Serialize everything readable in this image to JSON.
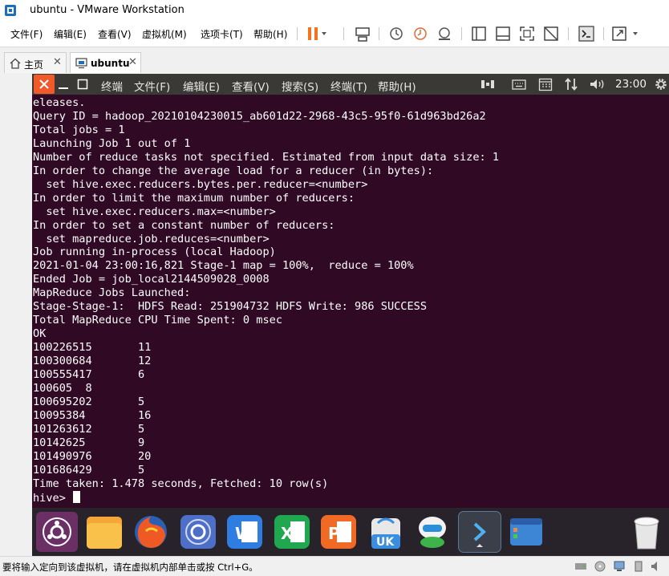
{
  "window": {
    "title": "ubuntu - VMware Workstation"
  },
  "menu": {
    "items": [
      "文件(F)",
      "编辑(E)",
      "查看(V)",
      "虚拟机(M)",
      "选项卡(T)",
      "帮助(H)"
    ]
  },
  "tabs": [
    {
      "label": "主页"
    },
    {
      "label": "ubuntu"
    }
  ],
  "ubuntu": {
    "app_name": "终端",
    "menu": [
      "文件(F)",
      "编辑(E)",
      "查看(V)",
      "搜索(S)",
      "终端(T)",
      "帮助(H)"
    ],
    "clock": "23:00"
  },
  "terminal": {
    "lines": [
      "eleases.",
      "Query ID = hadoop_20210104230015_ab601d22-2968-43c5-95f0-61d963bd26a2",
      "Total jobs = 1",
      "Launching Job 1 out of 1",
      "Number of reduce tasks not specified. Estimated from input data size: 1",
      "In order to change the average load for a reducer (in bytes):",
      "  set hive.exec.reducers.bytes.per.reducer=<number>",
      "In order to limit the maximum number of reducers:",
      "  set hive.exec.reducers.max=<number>",
      "In order to set a constant number of reducers:",
      "  set mapreduce.job.reduces=<number>",
      "Job running in-process (local Hadoop)",
      "2021-01-04 23:00:16,821 Stage-1 map = 100%,  reduce = 100%",
      "Ended Job = job_local2144509028_0008",
      "MapReduce Jobs Launched:",
      "Stage-Stage-1:  HDFS Read: 251904732 HDFS Write: 986 SUCCESS",
      "Total MapReduce CPU Time Spent: 0 msec",
      "OK",
      "100226515\t11",
      "100300684\t12",
      "100555417\t6",
      "100605\t8",
      "100695202\t5",
      "10095384\t16",
      "101263612\t5",
      "10142625\t9",
      "101490976\t20",
      "101686429\t5",
      "Time taken: 1.478 seconds, Fetched: 10 row(s)"
    ],
    "prompt": "hive> "
  },
  "dock": {
    "items": [
      {
        "icon": "ubuntu-logo-icon",
        "color": "#7a2f72"
      },
      {
        "icon": "files-folder-icon",
        "color": "#f4a636"
      },
      {
        "icon": "firefox-icon",
        "color": "#ef5a24"
      },
      {
        "icon": "chromium-icon",
        "color": "#6a8fd8"
      },
      {
        "icon": "wps-writer-icon",
        "color": "#2f7de1"
      },
      {
        "icon": "wps-spreadsheet-icon",
        "color": "#1fa84f"
      },
      {
        "icon": "wps-presentation-icon",
        "color": "#f06a26"
      },
      {
        "icon": "ubuntukylin-software-icon",
        "color": "#e8e8e8",
        "text": "UK"
      },
      {
        "icon": "robot-assistant-icon",
        "color": "#2a8ed8"
      },
      {
        "icon": "terminal-icon",
        "color": "#4a4a4a"
      },
      {
        "icon": "workspace-switcher-icon",
        "color": "#3d86d6"
      },
      {
        "icon": "trash-icon",
        "color": "#e6e6e6"
      }
    ]
  },
  "statusbar": {
    "text": "要将输入定向到该虚拟机，请在虚拟机内部单击或按 Ctrl+G。"
  },
  "colors": {
    "terminal_bg": "#300a24",
    "ubuntu_topbar": "#3b3935",
    "close_button": "#f0592a",
    "pause_button": "#f37321"
  }
}
